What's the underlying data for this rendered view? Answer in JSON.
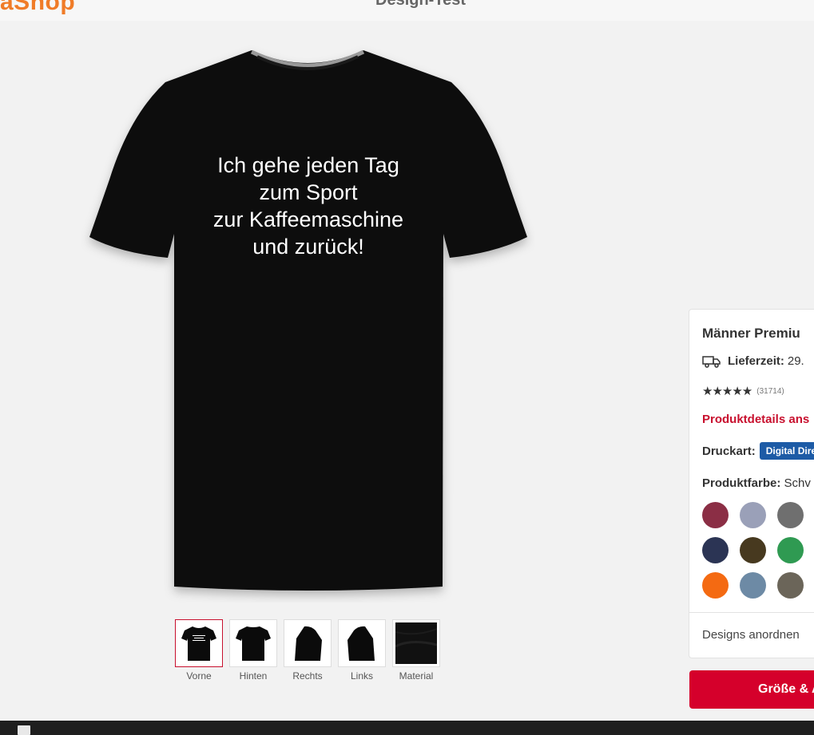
{
  "header": {
    "logo": "aShop",
    "design_title": "Design-Test"
  },
  "product_image": {
    "shirt_color": "#0b0b0b",
    "print_lines": [
      "Ich gehe jeden Tag",
      "zum Sport",
      "zur Kaffeemaschine",
      "und zurück!"
    ]
  },
  "views": [
    {
      "label": "Vorne"
    },
    {
      "label": "Hinten"
    },
    {
      "label": "Rechts"
    },
    {
      "label": "Links"
    },
    {
      "label": "Material"
    }
  ],
  "panel": {
    "title": "Männer Premiu",
    "delivery_label": "Lieferzeit:",
    "delivery_value": "29.",
    "stars": "★★★★★",
    "rating_count": "(31714)",
    "details_link": "Produktdetails ans",
    "print_label": "Druckart:",
    "print_value": "Digital Dire",
    "color_label": "Produktfarbe:",
    "color_value": "Schv",
    "swatches": [
      "#8b2e45",
      "#9aa0b8",
      "#6f6f6f",
      "#2b3454",
      "#47391f",
      "#2f9a52",
      "#f46a12",
      "#6d8aa5",
      "#6b6559"
    ],
    "arrange_designs": "Designs anordnen"
  },
  "cta": {
    "label": "Größe & A"
  },
  "colors": {
    "accent_red": "#d5002b",
    "link_red": "#c8102e",
    "badge_blue": "#1d5ba6",
    "logo_orange": "#f07c28"
  }
}
